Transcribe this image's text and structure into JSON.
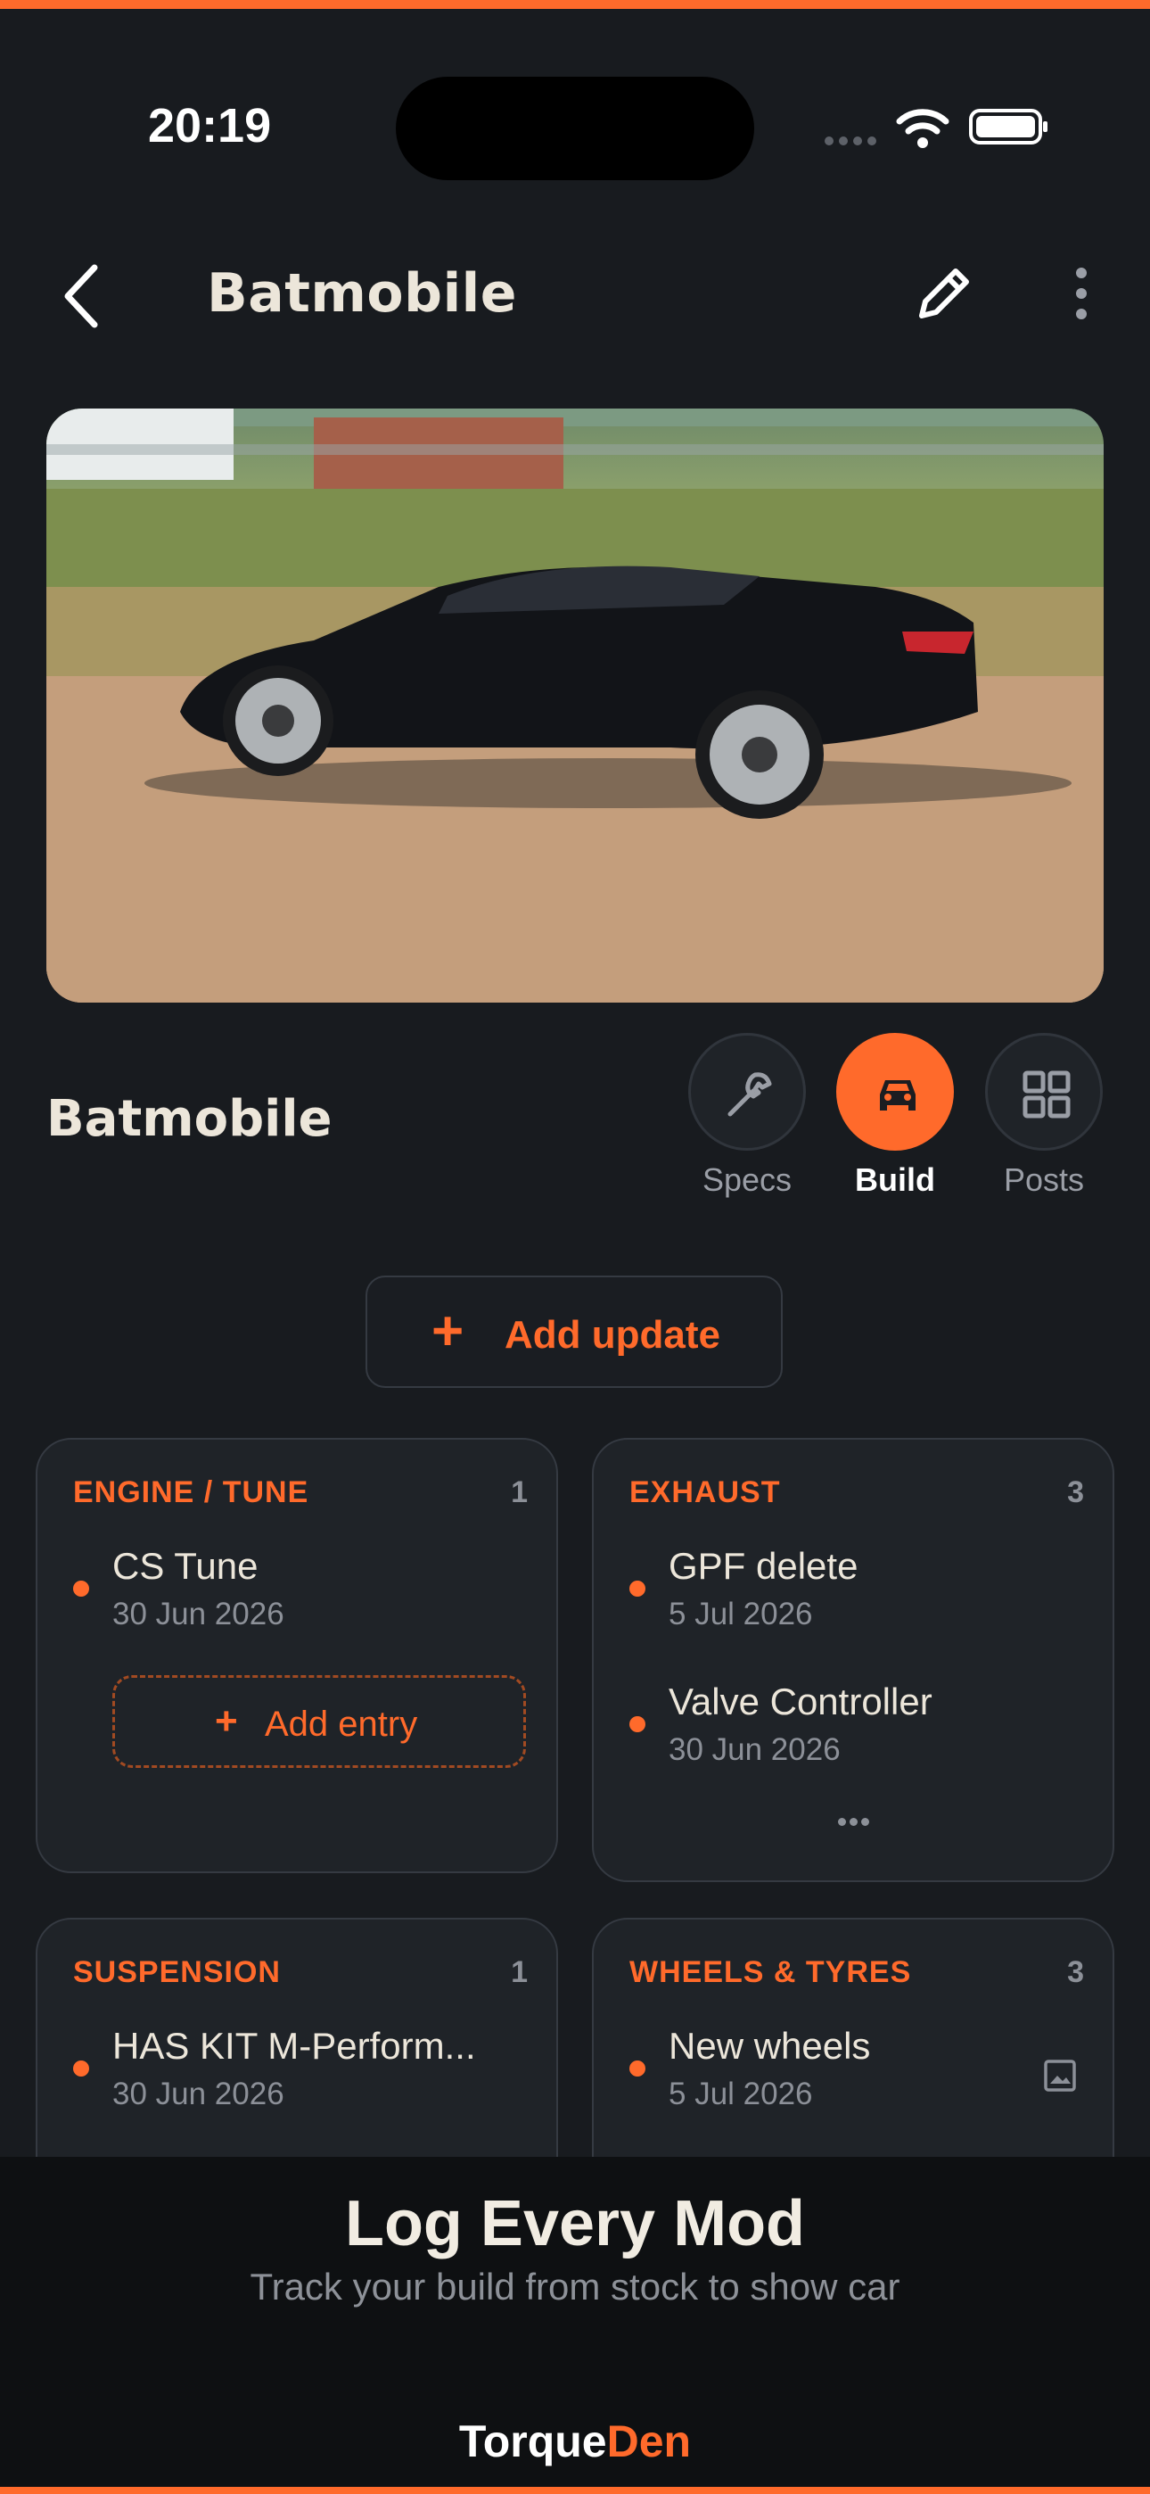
{
  "status": {
    "time": "20:19"
  },
  "header": {
    "title": "Batmobile"
  },
  "vehicle": {
    "name": "Batmobile"
  },
  "tabs": [
    {
      "label": "Specs",
      "icon": "wrench-icon",
      "active": false
    },
    {
      "label": "Build",
      "icon": "car-icon",
      "active": true
    },
    {
      "label": "Posts",
      "icon": "grid-icon",
      "active": false
    }
  ],
  "actions": {
    "add_update_icon": "+",
    "add_update": "Add update"
  },
  "categories": [
    {
      "name": "ENGINE / TUNE",
      "count": "1",
      "entries": [
        {
          "title": "CS Tune",
          "date": "30 Jun 2026"
        }
      ],
      "add_entry_icon": "+",
      "add_entry": "Add entry"
    },
    {
      "name": "EXHAUST",
      "count": "3",
      "entries": [
        {
          "title": "GPF delete",
          "date": "5 Jul 2026"
        },
        {
          "title": "Valve Controller",
          "date": "30 Jun 2026"
        }
      ]
    },
    {
      "name": "SUSPENSION",
      "count": "1",
      "entries": [
        {
          "title": "HAS KIT M-Perform...",
          "date": "30 Jun 2026"
        }
      ]
    },
    {
      "name": "WHEELS & TYRES",
      "count": "3",
      "entries": [
        {
          "title": "New wheels",
          "date": "5 Jul 2026"
        }
      ]
    }
  ],
  "promo": {
    "title": "Log Every Mod",
    "subtitle": "Track your build from stock to show car"
  },
  "brand": {
    "part1": "Torque",
    "part2": "Den"
  },
  "colors": {
    "accent": "#ff6a2b",
    "background": "#181b1f",
    "card": "#1f2328"
  }
}
